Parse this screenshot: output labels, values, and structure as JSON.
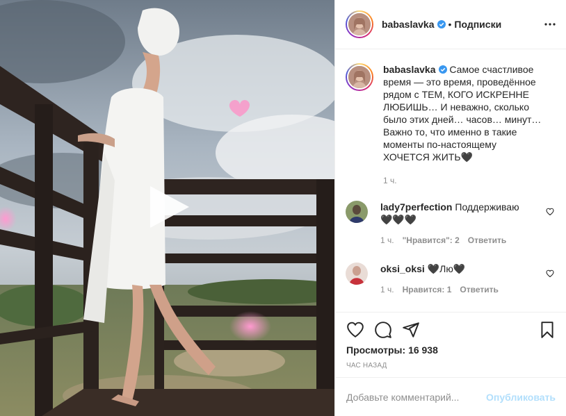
{
  "header": {
    "username": "babaslavka",
    "separator": "•",
    "follow_label": "Подписки",
    "icons": {
      "verified": "verified-badge-icon",
      "more": "more-options-icon"
    }
  },
  "caption": {
    "username": "babaslavka",
    "text": "Самое счастливое время — это время, проведённое рядом с ТЕМ, КОГО ИСКРЕННЕ ЛЮБИШЬ… И неважно, сколько было этих дней… часов… минут… Важно то, что именно в такие моменты по-настоящему ХОЧЕТСЯ ЖИТЬ🖤",
    "time": "1 ч."
  },
  "comments": [
    {
      "username": "lady7perfection",
      "text": "Поддерживаю 🖤🖤🖤",
      "time": "1 ч.",
      "likes_label": "\"Нравится\": 2",
      "reply_label": "Ответить"
    },
    {
      "username": "oksi_oksi",
      "text": "🖤Лю🖤",
      "time": "1 ч.",
      "likes_label": "Нравится: 1",
      "reply_label": "Ответить"
    }
  ],
  "actions": {
    "icons": [
      "like-heart-icon",
      "comment-bubble-icon",
      "share-plane-icon",
      "save-bookmark-icon"
    ],
    "views_label": "Просмотры:",
    "views_count": "16 938",
    "posted_ago": "ЧАС НАЗАД"
  },
  "add_comment": {
    "placeholder": "Добавьте комментарий...",
    "publish_label": "Опубликовать",
    "publish_color": "#b2dffc"
  },
  "media": {
    "type": "video",
    "play_icon": "play-icon"
  },
  "colors": {
    "text": "#262626",
    "secondary": "#8e8e8e",
    "border": "#efefef",
    "verified": "#3897f0"
  }
}
